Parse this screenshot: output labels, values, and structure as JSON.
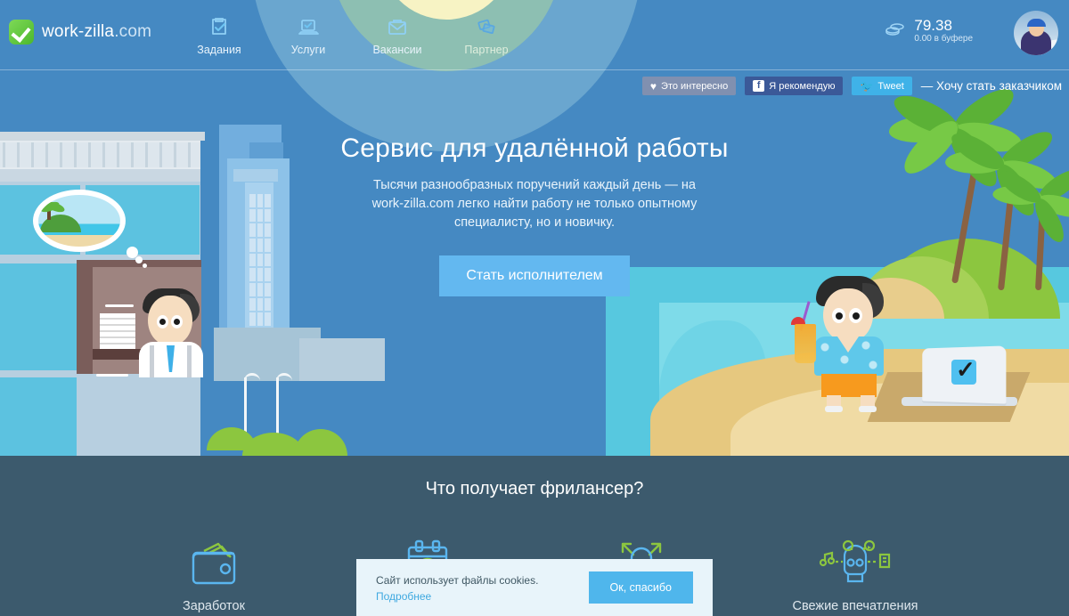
{
  "header": {
    "logo": {
      "name": "work-zilla",
      "domain": ".com"
    },
    "nav": [
      {
        "label": "Задания",
        "icon": "clipboard-check-icon"
      },
      {
        "label": "Услуги",
        "icon": "laptop-check-icon"
      },
      {
        "label": "Вакансии",
        "icon": "briefcase-icon"
      },
      {
        "label": "Партнер",
        "icon": "handshake-cards-icon"
      }
    ],
    "balance": {
      "amount": "79.38",
      "buffer": "0.00 в буфере",
      "icon": "coins-icon"
    },
    "avatar": "user-avatar"
  },
  "social": {
    "like": "Это интересно",
    "facebook": "Я рекомендую",
    "twitter": "Tweet",
    "customer_link": "— Хочу стать заказчиком"
  },
  "hero": {
    "title": "Сервис для удалённой работы",
    "subtitle_line1": "Тысячи разнообразных поручений каждый день — на",
    "subtitle_line2": "work-zilla.com легко найти работу не только опытному",
    "subtitle_line3": "специалисту, но и новичку.",
    "cta": "Стать исполнителем"
  },
  "features": {
    "title": "Что получает фрилансер?",
    "items": [
      {
        "label": "Заработок",
        "icon": "wallet-icon"
      },
      {
        "label": "",
        "icon": "calendar-clock-icon"
      },
      {
        "label": "",
        "icon": "growth-person-icon"
      },
      {
        "label": "Свежие впечатления",
        "icon": "person-media-icon"
      }
    ]
  },
  "cookie": {
    "text": "Сайт использует файлы cookies.",
    "link": "Подробнее",
    "button": "Ок, спасибо"
  },
  "colors": {
    "hero_bg": "#4589c2",
    "features_bg": "#3c5a6d",
    "cta": "#63b8f0",
    "accent_blue": "#4fb6ec",
    "accent_green": "#8cc63f",
    "logo_green": "#4cb82c",
    "facebook": "#3b5998",
    "twitter": "#3fb2e8"
  }
}
